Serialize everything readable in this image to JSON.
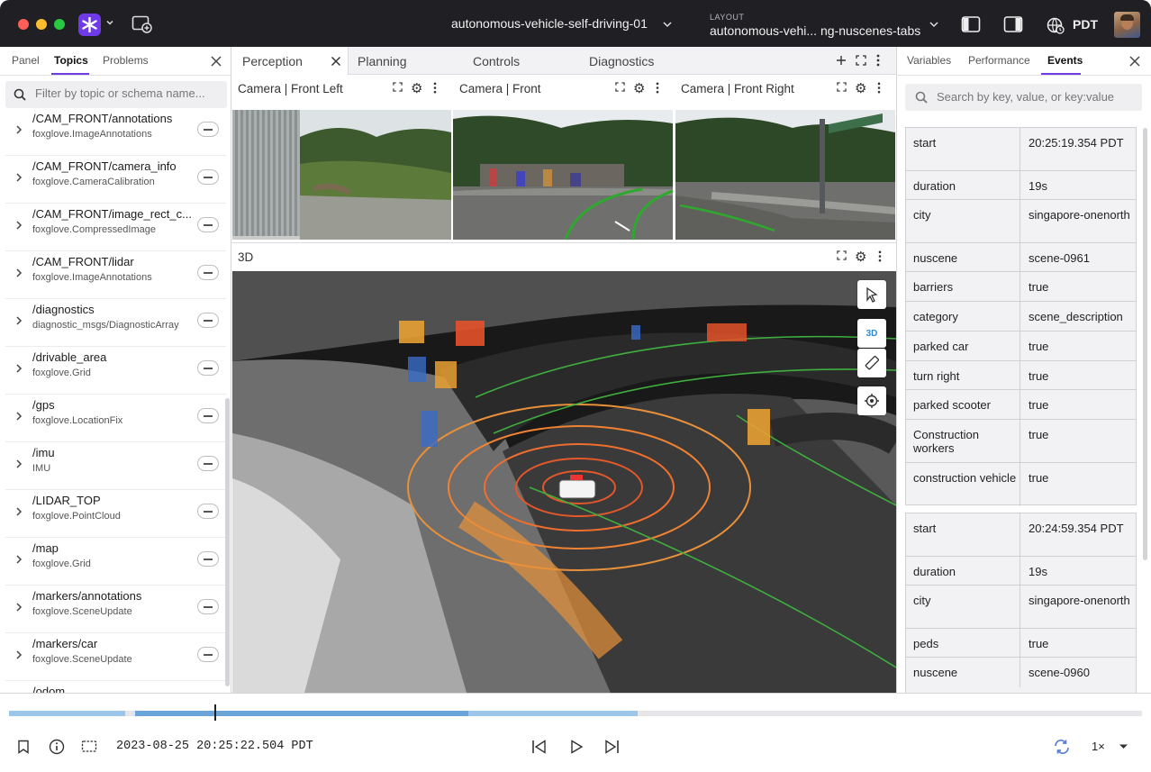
{
  "titlebar": {
    "data_source": "autonomous-vehicle-self-driving-01",
    "layout_label": "LAYOUT",
    "layout_name": "autonomous-vehi... ng-nuscenes-tabs",
    "timezone": "PDT"
  },
  "left_panel": {
    "tabs": [
      "Panel",
      "Topics",
      "Problems"
    ],
    "active_tab": "Topics",
    "search_placeholder": "Filter by topic or schema name...",
    "topics": [
      {
        "name": "/CAM_FRONT/annotations",
        "schema": "foxglove.ImageAnnotations"
      },
      {
        "name": "/CAM_FRONT/camera_info",
        "schema": "foxglove.CameraCalibration"
      },
      {
        "name": "/CAM_FRONT/image_rect_c...",
        "schema": "foxglove.CompressedImage"
      },
      {
        "name": "/CAM_FRONT/lidar",
        "schema": "foxglove.ImageAnnotations"
      },
      {
        "name": "/diagnostics",
        "schema": "diagnostic_msgs/DiagnosticArray"
      },
      {
        "name": "/drivable_area",
        "schema": "foxglove.Grid"
      },
      {
        "name": "/gps",
        "schema": "foxglove.LocationFix"
      },
      {
        "name": "/imu",
        "schema": "IMU"
      },
      {
        "name": "/LIDAR_TOP",
        "schema": "foxglove.PointCloud"
      },
      {
        "name": "/map",
        "schema": "foxglove.Grid"
      },
      {
        "name": "/markers/annotations",
        "schema": "foxglove.SceneUpdate"
      },
      {
        "name": "/markers/car",
        "schema": "foxglove.SceneUpdate"
      },
      {
        "name": "/odom",
        "schema": ""
      }
    ]
  },
  "center": {
    "tabs": [
      "Perception",
      "Planning",
      "Controls",
      "Diagnostics"
    ],
    "active_tab": "Perception",
    "panels": {
      "cam_left": "Camera | Front Left",
      "cam_front": "Camera | Front",
      "cam_right": "Camera | Front Right",
      "three_d": "3D"
    },
    "viewport_mode_label": "3D"
  },
  "right_panel": {
    "tabs": [
      "Variables",
      "Performance",
      "Events"
    ],
    "active_tab": "Events",
    "search_placeholder": "Search by key, value, or key:value",
    "events": [
      {
        "rows": [
          {
            "key": "start",
            "value": "20:25:19.354 PDT"
          },
          {
            "key": "duration",
            "value": "19s"
          },
          {
            "key": "city",
            "value": "singapore-onenorth"
          },
          {
            "key": "nuscene",
            "value": "scene-0961"
          },
          {
            "key": "barriers",
            "value": "true"
          },
          {
            "key": "category",
            "value": "scene_description"
          },
          {
            "key": "parked car",
            "value": "true"
          },
          {
            "key": "turn right",
            "value": "true"
          },
          {
            "key": "parked scooter",
            "value": "true"
          },
          {
            "key": "Construction workers",
            "value": "true"
          },
          {
            "key": "construction vehicle",
            "value": "true"
          }
        ]
      },
      {
        "rows": [
          {
            "key": "start",
            "value": "20:24:59.354 PDT"
          },
          {
            "key": "duration",
            "value": "19s"
          },
          {
            "key": "city",
            "value": "singapore-onenorth"
          },
          {
            "key": "peds",
            "value": "true"
          },
          {
            "key": "nuscene",
            "value": "scene-0960"
          }
        ]
      }
    ]
  },
  "playback": {
    "timestamp": "2023-08-25 20:25:22.504 PDT",
    "speed": "1×"
  },
  "colors": {
    "accent": "#6f3be8",
    "timeline_loaded": "#9ec6ea",
    "timeline_active": "#6aa4d8"
  }
}
